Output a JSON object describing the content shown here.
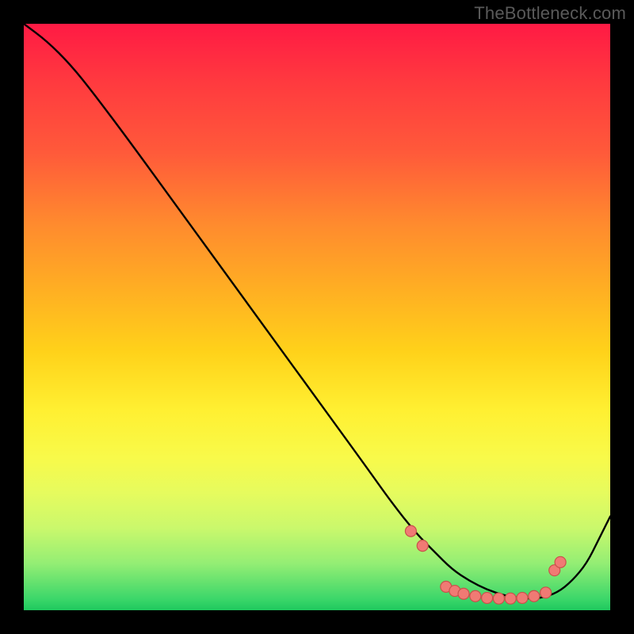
{
  "watermark": "TheBottleneck.com",
  "chart_data": {
    "type": "line",
    "title": "",
    "xlabel": "",
    "ylabel": "",
    "xlim": [
      0,
      100
    ],
    "ylim": [
      0,
      100
    ],
    "series": [
      {
        "name": "curve",
        "color": "#000000",
        "x": [
          0,
          4,
          8,
          12,
          18,
          26,
          34,
          42,
          50,
          58,
          63,
          67,
          70,
          73,
          76,
          79,
          82,
          85,
          88,
          91,
          93.5,
          96,
          98,
          100
        ],
        "y": [
          100,
          97,
          93,
          88,
          80,
          69,
          58,
          47,
          36,
          25,
          18,
          13,
          10,
          7,
          5,
          3.5,
          2.5,
          2,
          2,
          3,
          5,
          8,
          12,
          16
        ]
      }
    ],
    "markers": [
      {
        "x": 66,
        "y": 13.5
      },
      {
        "x": 68,
        "y": 11.0
      },
      {
        "x": 72,
        "y": 4.0
      },
      {
        "x": 73.5,
        "y": 3.3
      },
      {
        "x": 75,
        "y": 2.8
      },
      {
        "x": 77,
        "y": 2.4
      },
      {
        "x": 79,
        "y": 2.1
      },
      {
        "x": 81,
        "y": 2.0
      },
      {
        "x": 83,
        "y": 2.0
      },
      {
        "x": 85,
        "y": 2.1
      },
      {
        "x": 87,
        "y": 2.4
      },
      {
        "x": 89,
        "y": 3.0
      },
      {
        "x": 90.5,
        "y": 6.8
      },
      {
        "x": 91.5,
        "y": 8.2
      }
    ],
    "marker_style": {
      "fill": "#f07a74",
      "stroke": "#c9514b",
      "r": 7
    }
  }
}
